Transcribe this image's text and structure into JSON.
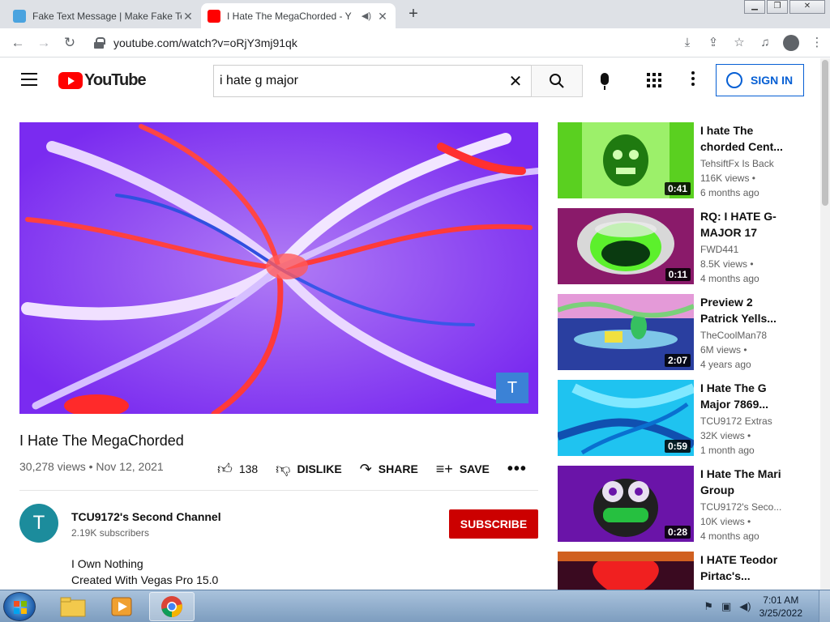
{
  "browser": {
    "tabs": [
      {
        "title": "Fake Text Message | Make Fake Te",
        "favicon_color": "#4aa3df"
      },
      {
        "title": "I Hate The MegaChorded - Y",
        "favicon_color": "#ff0000"
      }
    ],
    "new_tab": "+",
    "url": "youtube.com/watch?v=oRjY3mj91qk"
  },
  "youtube": {
    "logo_text": "YouTube",
    "search_query": "i hate g major",
    "sign_in_label": "SIGN IN",
    "brand_red": "#ff0000",
    "link_blue": "#065fd4"
  },
  "video": {
    "watermark": "T",
    "title": "I Hate The MegaChorded",
    "meta": "30,278 views • Nov 12, 2021",
    "likes": "138",
    "dislike_label": "DISLIKE",
    "share_label": "SHARE",
    "save_label": "SAVE",
    "more_label": "•••"
  },
  "channel": {
    "avatar_letter": "T",
    "name": "TCU9172's Second Channel",
    "subscribers": "2.19K subscribers",
    "subscribe_label": "SUBSCRIBE",
    "description": [
      "I Own Nothing",
      "Created With Vegas Pro 15.0"
    ]
  },
  "recommendations": [
    {
      "title": "I hate The chorded Cent...",
      "channel": "TehsiftFx Is Back",
      "views": "116K views •",
      "age": "6 months ago",
      "duration": "0:41",
      "bg": "#5ad020",
      "accent": "#1f7a10"
    },
    {
      "title": "RQ: I HATE G-MAJOR 17",
      "channel": "FWD441",
      "views": "8.5K views •",
      "age": "4 months ago",
      "duration": "0:11",
      "bg": "#8a1a6a",
      "accent": "#5cf02c"
    },
    {
      "title": "Preview 2 Patrick Yells...",
      "channel": "TheCoolMan78",
      "views": "6M views •",
      "age": "4 years ago",
      "duration": "2:07",
      "bg": "#e49ad8",
      "accent": "#2a3fa0"
    },
    {
      "title": "I Hate The G Major 7869...",
      "channel": "TCU9172 Extras",
      "views": "32K views •",
      "age": "1 month ago",
      "duration": "0:59",
      "bg": "#1fc3f0",
      "accent": "#1050b0"
    },
    {
      "title": "I Hate The Mari Group",
      "channel": "TCU9172's Seco...",
      "views": "10K views •",
      "age": "4 months ago",
      "duration": "0:28",
      "bg": "#6a14a8",
      "accent": "#26c040"
    },
    {
      "title": "I HATE Teodor Pirtac's...",
      "channel": "",
      "views": "",
      "age": "",
      "duration": "",
      "bg": "#c01818",
      "accent": "#f02020"
    }
  ],
  "taskbar": {
    "time": "7:01 AM",
    "date": "3/25/2022"
  }
}
